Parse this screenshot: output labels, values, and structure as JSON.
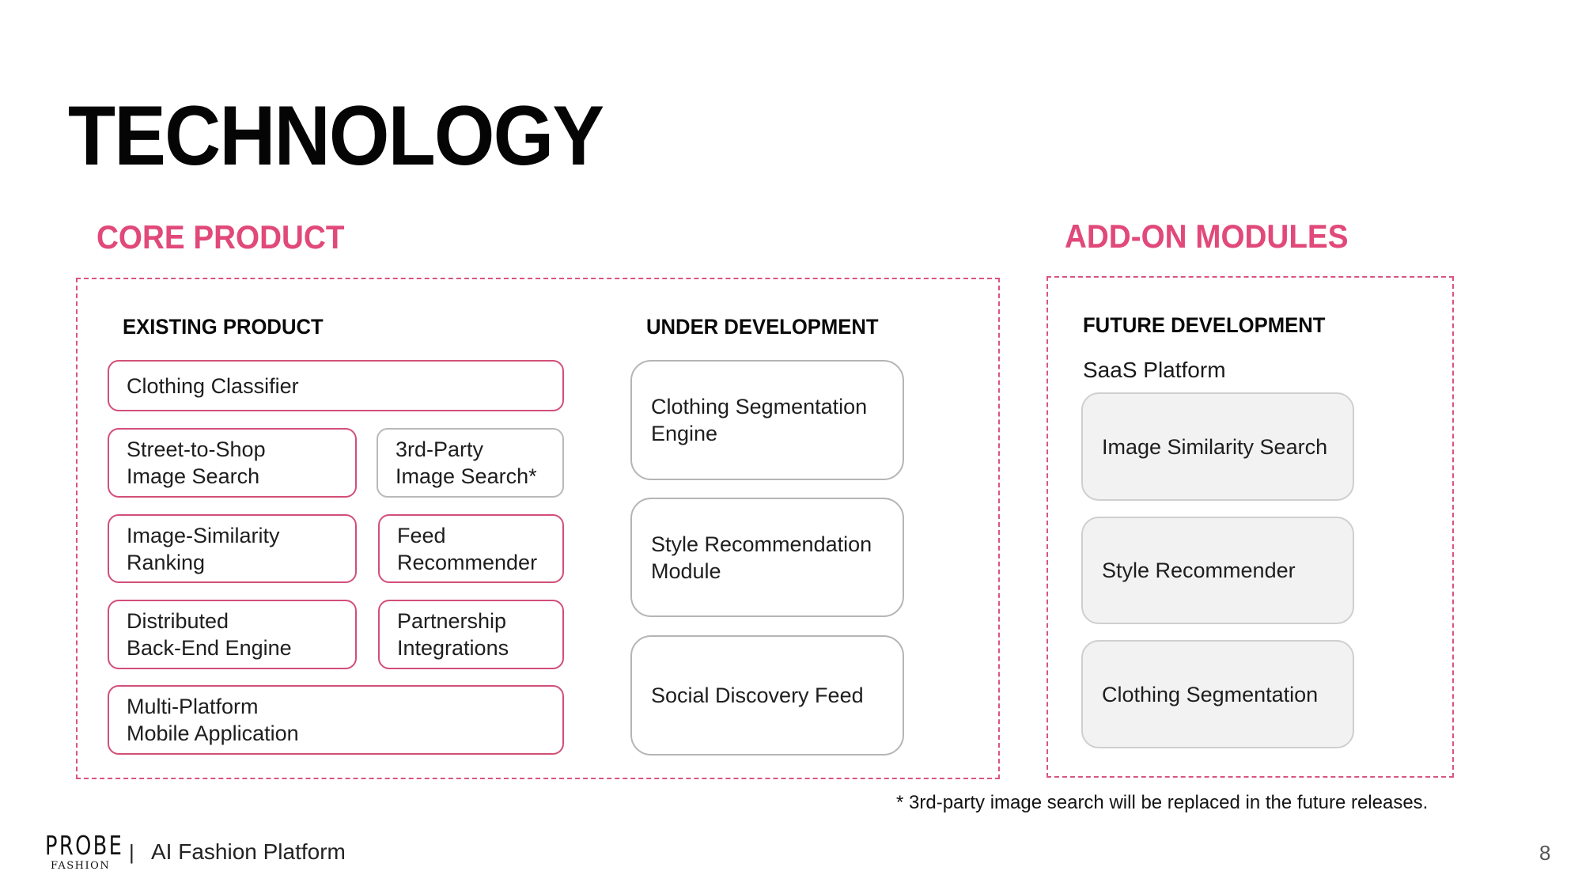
{
  "page": {
    "title": "TECHNOLOGY",
    "page_number": "8"
  },
  "core_product": {
    "title": "CORE PRODUCT",
    "existing": {
      "heading": "EXISTING PRODUCT",
      "items": [
        {
          "label": "Clothing Classifier",
          "style": "pink"
        },
        {
          "label": "Street-to-Shop\nImage Search",
          "style": "pink"
        },
        {
          "label": "3rd-Party\nImage Search*",
          "style": "gray"
        },
        {
          "label": "Image-Similarity\nRanking",
          "style": "pink"
        },
        {
          "label": "Feed\nRecommender",
          "style": "pink"
        },
        {
          "label": "Distributed\nBack-End Engine",
          "style": "pink"
        },
        {
          "label": "Partnership\nIntegrations",
          "style": "pink"
        },
        {
          "label": "Multi-Platform\nMobile Application",
          "style": "pink"
        }
      ]
    },
    "under_development": {
      "heading": "UNDER DEVELOPMENT",
      "items": [
        {
          "label": "Clothing Segmentation\nEngine"
        },
        {
          "label": "Style Recommendation\nModule"
        },
        {
          "label": "Social Discovery Feed"
        }
      ]
    }
  },
  "add_on_modules": {
    "title": "ADD-ON MODULES",
    "future": {
      "heading": "FUTURE DEVELOPMENT",
      "subheading": "SaaS Platform",
      "items": [
        {
          "label": "Image Similarity Search"
        },
        {
          "label": "Style Recommender"
        },
        {
          "label": "Clothing Segmentation"
        }
      ]
    }
  },
  "footnote": "* 3rd-party image search will be replaced in the future releases.",
  "footer": {
    "logo_main": "PROBE",
    "logo_sub": "FASHION",
    "separator": "|",
    "tagline": "AI Fashion Platform"
  },
  "colors": {
    "accent_pink": "#e1497a",
    "box_border_pink": "#d24f78",
    "box_border_gray": "#b9b9b9",
    "future_box_fill": "#f3f2f3"
  }
}
